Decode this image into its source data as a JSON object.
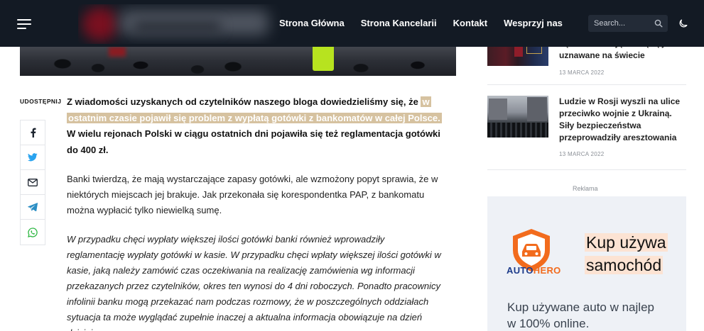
{
  "header": {
    "nav": [
      "Strona Główna",
      "Strona Kancelarii",
      "Kontakt",
      "Wesprzyj nas"
    ],
    "search_placeholder": "Search...",
    "icons": [
      "menu-icon",
      "search-icon",
      "moon-icon"
    ]
  },
  "share": {
    "label": "UDOSTĘPNIJ",
    "buttons": [
      "facebook-icon",
      "twitter-icon",
      "email-icon",
      "telegram-icon",
      "whatsapp-icon"
    ]
  },
  "article": {
    "lead_plain": "Z wiadomości uzyskanych od czytelników naszego bloga dowiedzieliśmy się, że ",
    "lead_highlight": "w ostatnim czasie pojawił się problem z wypłatą gotówki z bankomatów w całej Polsce.",
    "lead_rest": " W wielu rejonach Polski w ciągu ostatnich dni pojawiła się też reglamentacja gotówki do 400 zł.",
    "paragraph2": "Banki twierdzą, że mają wystarczające zapasy gotówki, ale wzmożony popyt sprawia, że w niektórych miejscach jej brakuje. Jak przekonała się korespondentka PAP, z bankomatu można wypłacić tylko niewielką sumę.",
    "paragraph3": "W przypadku chęci wypłaty większej ilości gotówki banki również wprowadziły reglamentację wypłaty gotówki w kasie. W przypadku chęci wpłaty większej ilości gotówki w kasie, jaką należy zamówić czas oczekiwania na realizację zamówienia wg informacji przekazanych przez czytelników, okres ten wynosi do 4 dni roboczych. Ponadto pracownicy infolinii banku mogą przekazać nam podczas rozmowy, że w poszczególnych oddziałach sytuacja ta może wyglądać zupełnie inaczej a aktualna informacja obowiązuje na dzień dzisiejszy."
  },
  "sidebar": {
    "posts": [
      {
        "title": "sądowe z Rosją nie będą już uznawane na świecie",
        "date": "13 MARCA 2022"
      },
      {
        "title": "Ludzie w Rosji wyszli na ulice przeciwko wojnie z Ukrainą. Siły bezpieczeństwa przeprowadziły aresztowania",
        "date": "13 MARCA 2022"
      }
    ],
    "ad_label": "Reklama",
    "ad": {
      "brand_a": "AUTO",
      "brand_b": "HERO",
      "headline_1": "Kup używa",
      "headline_2": "samochód",
      "subline_1": "Kup używane auto w najlep",
      "subline_2": "w 100% online."
    }
  },
  "colors": {
    "header_bg": "#131a24",
    "highlight": "#d6c2a0",
    "ad_bg": "#eef1f6",
    "brand_orange": "#f26b1d",
    "brand_blue": "#1d3b8a"
  }
}
